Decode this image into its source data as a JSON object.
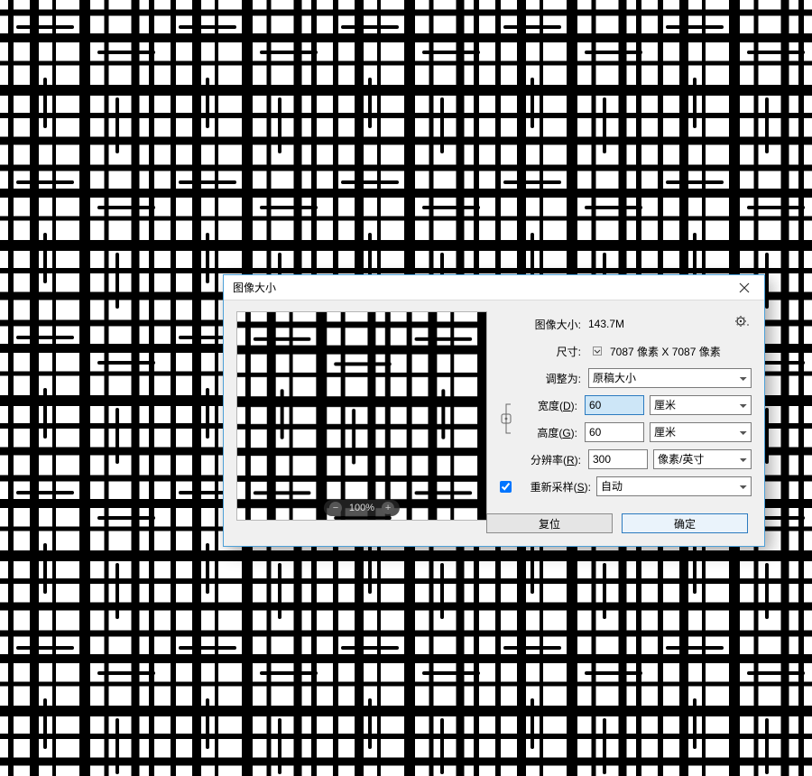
{
  "dialog": {
    "title": "图像大小",
    "imagesize_label": "图像大小:",
    "imagesize_value": "143.7M",
    "dimensions_label": "尺寸:",
    "dimensions_value": "7087 像素  X  7087 像素",
    "fit_label": "调整为:",
    "fit_value": "原稿大小",
    "width_label_pre": "宽度(",
    "width_label_key": "D",
    "width_label_post": "):",
    "width_value": "60",
    "width_unit": "厘米",
    "height_label_pre": "高度(",
    "height_label_key": "G",
    "height_label_post": "):",
    "height_value": "60",
    "height_unit": "厘米",
    "res_label_pre": "分辨率(",
    "res_label_key": "R",
    "res_label_post": "):",
    "res_value": "300",
    "res_unit": "像素/英寸",
    "resample_label_pre": "重新采样(",
    "resample_label_key": "S",
    "resample_label_post": "):",
    "resample_value": "自动",
    "zoom": "100%",
    "reset": "复位",
    "ok": "确定"
  }
}
